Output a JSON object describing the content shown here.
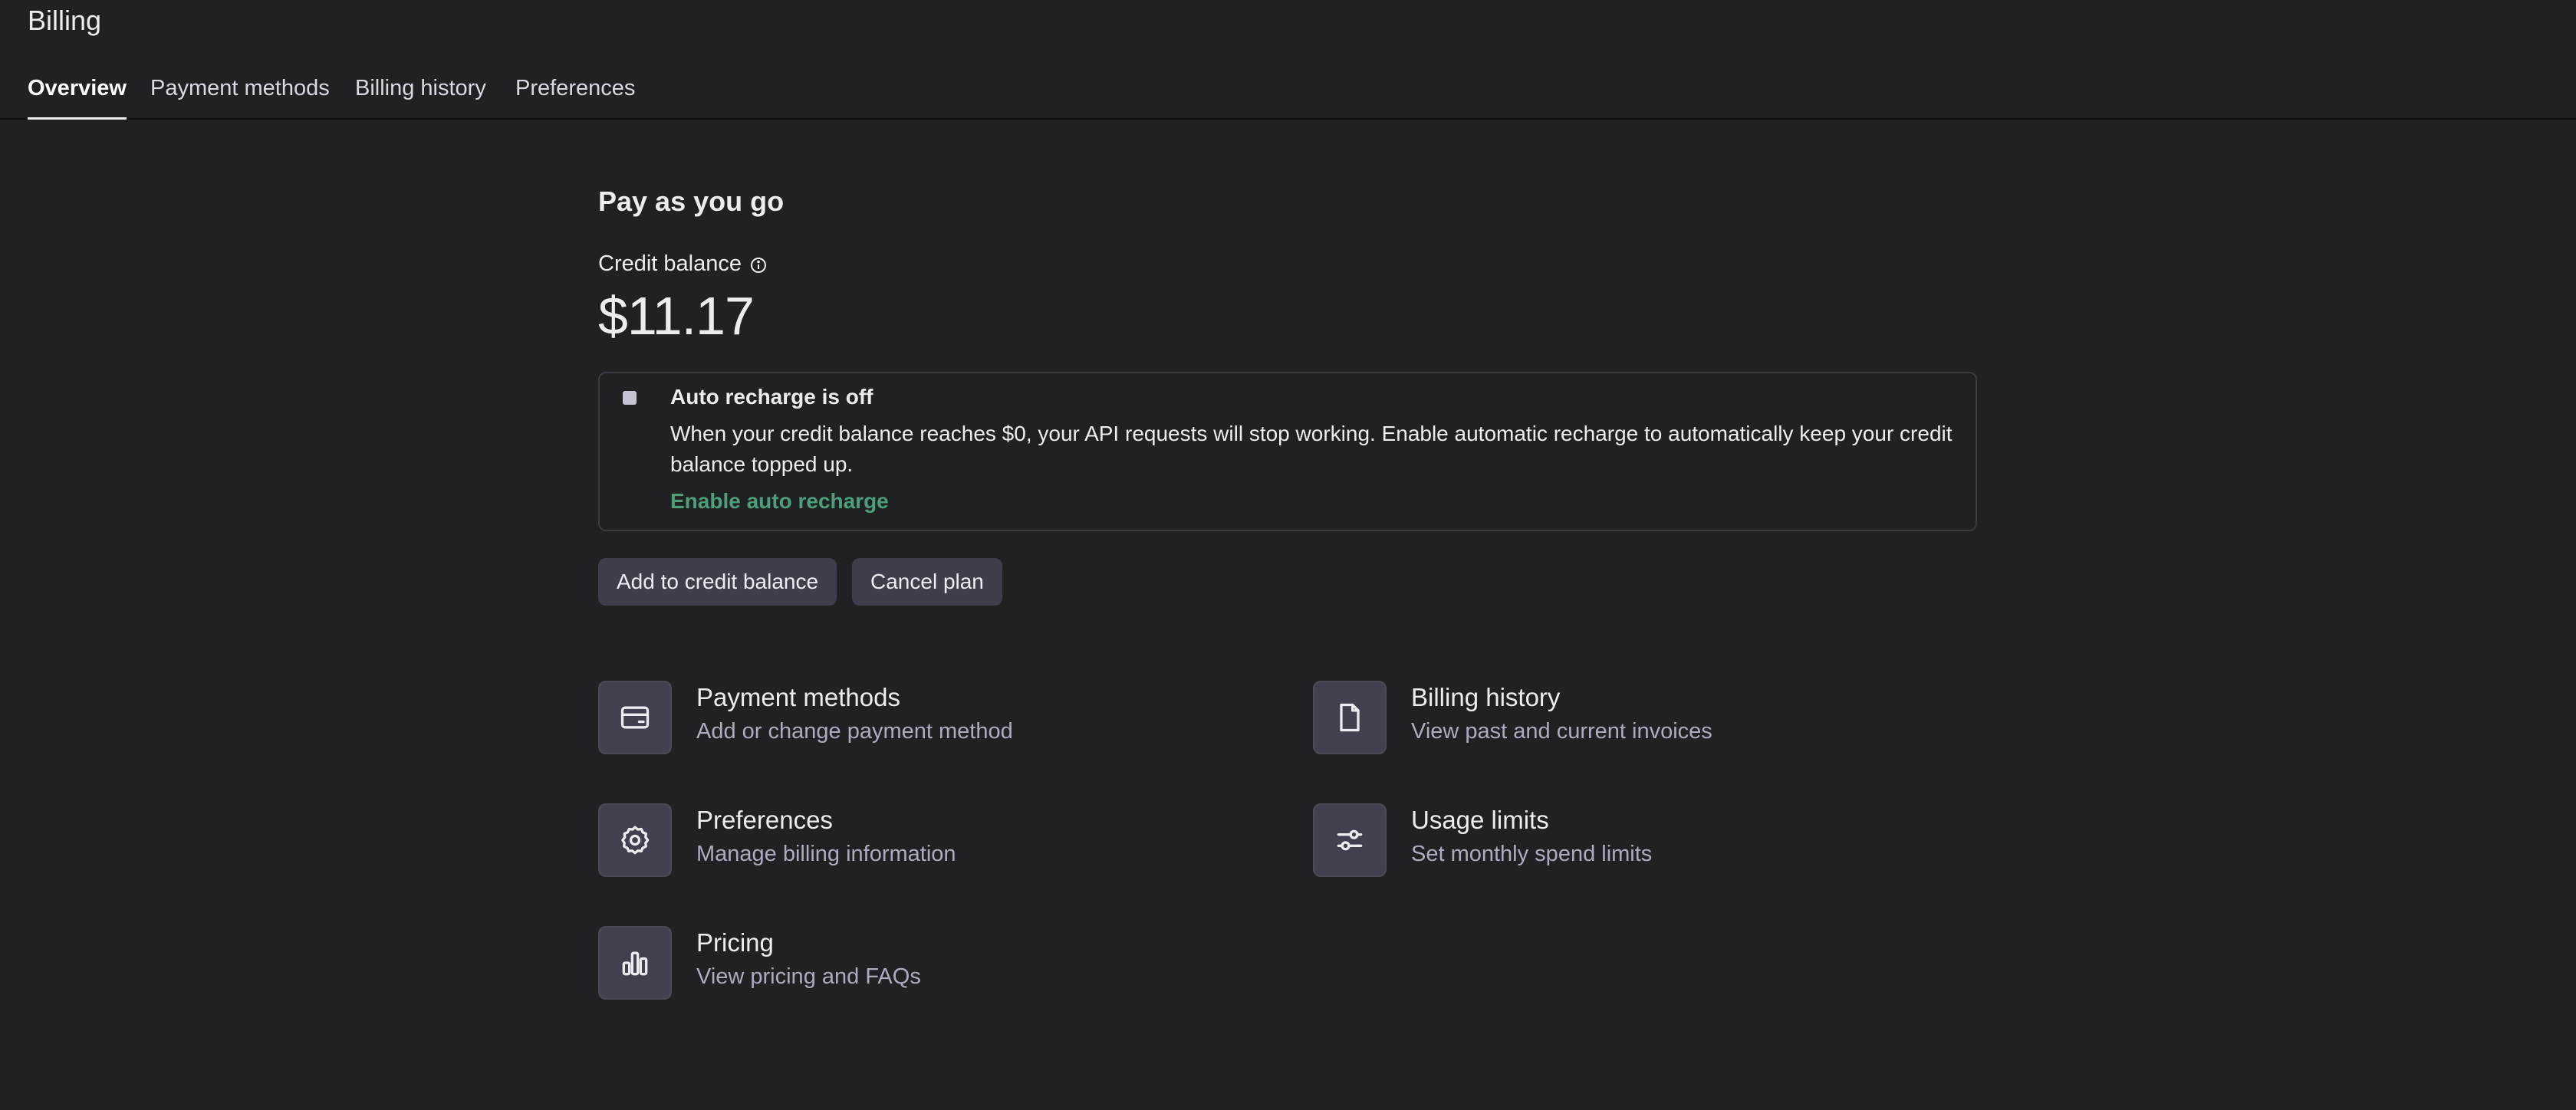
{
  "header": {
    "title": "Billing"
  },
  "tabs": [
    {
      "label": "Overview"
    },
    {
      "label": "Payment methods"
    },
    {
      "label": "Billing history"
    },
    {
      "label": "Preferences"
    }
  ],
  "plan": {
    "title": "Pay as you go",
    "credit_label": "Credit balance",
    "balance": "$11.17"
  },
  "notice": {
    "title": "Auto recharge is off",
    "text": "When your credit balance reaches $0, your API requests will stop working. Enable automatic recharge to automatically keep your credit balance topped up.",
    "link": "Enable auto recharge"
  },
  "actions": {
    "add_credit": "Add to credit balance",
    "cancel_plan": "Cancel plan"
  },
  "cards": [
    {
      "title": "Payment methods",
      "subtitle": "Add or change payment method",
      "icon": "credit-card-icon"
    },
    {
      "title": "Billing history",
      "subtitle": "View past and current invoices",
      "icon": "document-icon"
    },
    {
      "title": "Preferences",
      "subtitle": "Manage billing information",
      "icon": "gear-icon"
    },
    {
      "title": "Usage limits",
      "subtitle": "Set monthly spend limits",
      "icon": "sliders-icon"
    },
    {
      "title": "Pricing",
      "subtitle": "View pricing and FAQs",
      "icon": "bar-chart-icon"
    }
  ],
  "colors": {
    "background": "#202123",
    "accent_link": "#4e9e7a",
    "button_bg": "#3e3f4b"
  }
}
